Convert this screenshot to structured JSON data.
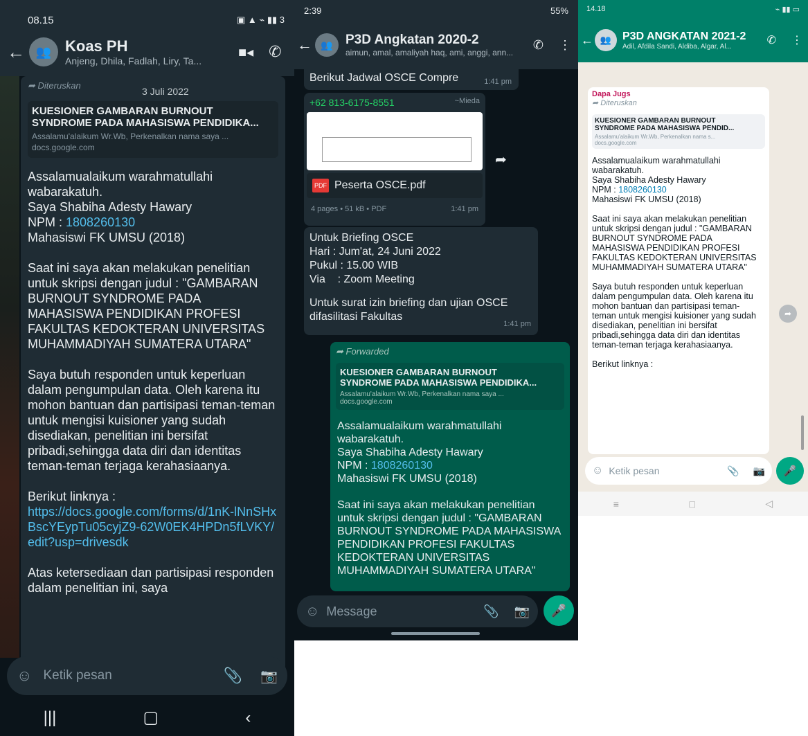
{
  "p1": {
    "status": {
      "time": "08.15",
      "right": "3"
    },
    "header": {
      "title": "Koas PH",
      "subtitle": "Anjeng, Dhila, Fadlah, Liry, Ta..."
    },
    "date_chip": "3 Juli 2022",
    "forwarded": "Diteruskan",
    "preview": {
      "title_line1": "KUESIONER GAMBARAN BURNOUT",
      "title_line2": "SYNDROME PADA MAHASISWA PENDIDIKA...",
      "desc": "Assalamu'alaikum Wr.Wb, Perkenalkan nama saya ...",
      "domain": "docs.google.com"
    },
    "msg": {
      "greeting": "Assalamualaikum warahmatullahi wabarakatuh.",
      "name": "Saya Shabiha Adesty Hawary",
      "npm_label": "NPM : ",
      "npm": "1808260130",
      "mahasiswa": "Mahasiswi  FK UMSU (2018)",
      "para1": "Saat ini saya akan melakukan  penelitian untuk skripsi dengan judul : \"GAMBARAN BURNOUT SYNDROME PADA MAHASISWA PENDIDIKAN PROFESI FAKULTAS KEDOKTERAN UNIVERSITAS MUHAMMADIYAH SUMATERA UTARA\"",
      "para2": "Saya butuh responden untuk keperluan dalam pengumpulan data. Oleh karena itu mohon bantuan dan partisipasi teman-teman untuk mengisi kuisioner yang sudah disediakan, penelitian ini bersifat pribadi,sehingga data diri dan identitas teman-teman terjaga kerahasiaanya.",
      "link_label": "Berikut linknya :",
      "link": "https://docs.google.com/forms/d/1nK-lNnSHxBscYEypTu05cyjZ9-62W0EK4HPDn5fLVKY/edit?usp=drivesdk",
      "para3": "Atas ketersediaan dan partisipasi responden dalam penelitian ini, saya"
    },
    "input_placeholder": "Ketik pesan"
  },
  "p2": {
    "status": {
      "time": "2:39",
      "battery": "55%"
    },
    "header": {
      "title": "P3D Angkatan 2020-2",
      "subtitle": "aimun, amal, amaliyah haq, ami, anggi, ann..."
    },
    "m1": {
      "text": "Berikut Jadwal OSCE Compre",
      "time": "1:41 pm"
    },
    "m2": {
      "sender": "+62 813-6175-8551",
      "sender_name": "~Mieda",
      "file_name": "Peserta OSCE.pdf",
      "file_info": "4 pages • 51 kB • PDF",
      "time": "1:41 pm"
    },
    "m3": {
      "line1": "Untuk Briefing OSCE",
      "line2": "Hari : Jum'at, 24 Juni 2022",
      "line3": "Pukul : 15.00 WIB",
      "line4": "Via    : Zoom Meeting",
      "line5": "Untuk surat izin briefing dan ujian OSCE difasilitasi Fakultas",
      "time": "1:41 pm"
    },
    "m4": {
      "forwarded": "Forwarded",
      "pv_title1": "KUESIONER GAMBARAN BURNOUT",
      "pv_title2": "SYNDROME PADA MAHASISWA PENDIDIKA...",
      "pv_desc": "Assalamu'alaikum Wr.Wb, Perkenalkan nama saya ...",
      "pv_domain": "docs.google.com",
      "greeting": "Assalamualaikum warahmatullahi wabarakatuh.",
      "name": "Saya Shabiha Adesty Hawary",
      "npm_label": "NPM : ",
      "npm": "1808260130",
      "mahasiswa": "Mahasiswi  FK UMSU (2018)",
      "para1": "Saat ini saya akan melakukan  penelitian untuk skripsi dengan judul : \"GAMBARAN BURNOUT SYNDROME PADA MAHASISWA PENDIDIKAN PROFESI FAKULTAS KEDOKTERAN UNIVERSITAS MUHAMMADIYAH SUMATERA UTARA\""
    },
    "input_placeholder": "Message"
  },
  "p3": {
    "status": {
      "time": "14.18"
    },
    "header": {
      "title": "P3D ANGKATAN 2021-2",
      "subtitle": "Adil, Afdila Sandi, Aldiba, Algar, Al..."
    },
    "sender": "Dapa Jugs",
    "forwarded": "Diteruskan",
    "preview": {
      "title_line1": "KUESIONER GAMBARAN BURNOUT",
      "title_line2": "SYNDROME PADA MAHASISWA PENDID...",
      "desc": "Assalamu'alaikum Wr.Wb, Perkenalkan nama s...",
      "domain": "docs.google.com"
    },
    "msg": {
      "greeting": "Assalamualaikum warahmatullahi wabarakatuh.",
      "name": "Saya Shabiha Adesty Hawary",
      "npm_label": "NPM : ",
      "npm": "1808260130",
      "mahasiswa": "Mahasiswi  FK UMSU (2018)",
      "para1": "Saat ini saya akan melakukan penelitian untuk skripsi dengan judul : \"GAMBARAN BURNOUT SYNDROME PADA MAHASISWA PENDIDIKAN PROFESI FAKULTAS KEDOKTERAN UNIVERSITAS MUHAMMADIYAH SUMATERA UTARA\"",
      "para2": "Saya butuh responden untuk keperluan dalam pengumpulan data. Oleh karena  itu mohon bantuan dan partisipasi teman-teman untuk mengisi kuisioner yang sudah disediakan, penelitian ini bersifat pribadi,sehingga data diri dan identitas teman-teman terjaga kerahasiaanya.",
      "link_label": "Berikut linknya :"
    },
    "input_placeholder": "Ketik pesan"
  },
  "colors": {
    "dark_bg": "#0b141a",
    "dark_header": "#1f2c34",
    "dark_bubble": "#1f2c34",
    "out_bubble": "#005c4b",
    "teal_header": "#008069",
    "accent": "#00a884",
    "link": "#53bdeb"
  }
}
